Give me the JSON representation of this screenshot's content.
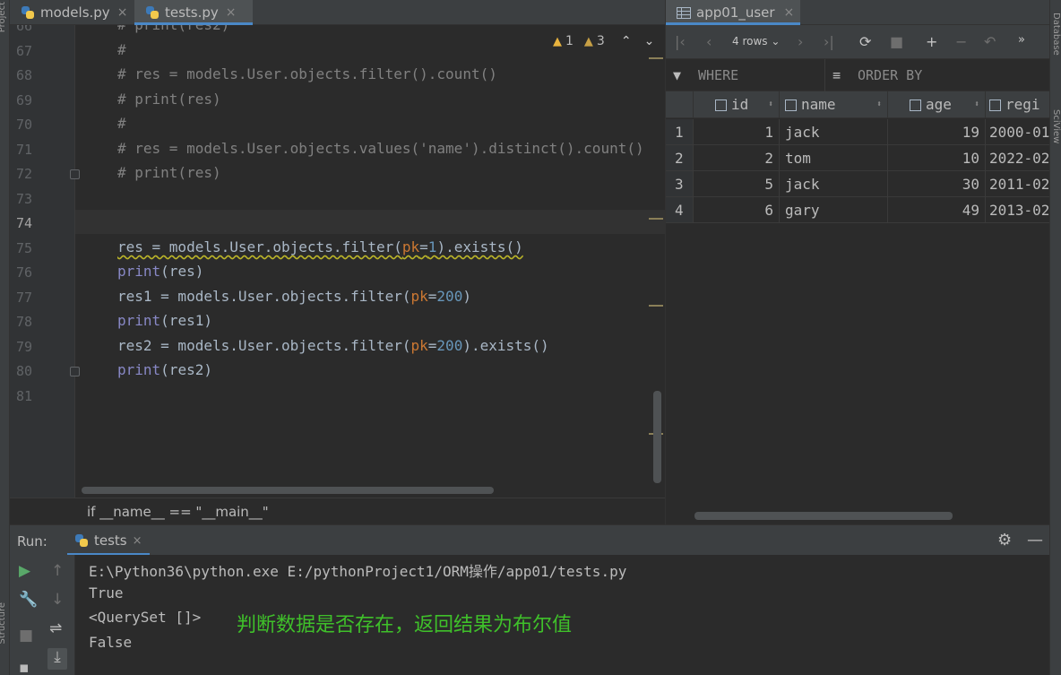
{
  "side_labels": {
    "left_top": "Project",
    "left_bottom": "Structure",
    "right_top": "Database",
    "right_mid": "SciView"
  },
  "editor_tabs": [
    {
      "label": "models.py",
      "close": "×"
    },
    {
      "label": "tests.py",
      "close": "×"
    }
  ],
  "inspections": {
    "warnings": "1",
    "weak_warnings": "3"
  },
  "line_numbers": [
    "66",
    "67",
    "68",
    "69",
    "70",
    "71",
    "72",
    "73",
    "74",
    "75",
    "76",
    "77",
    "78",
    "79",
    "80",
    "81"
  ],
  "code": {
    "l66": "# print(res2)",
    "l67": "#",
    "l68": "# res = models.User.objects.filter().count()",
    "l69": "# print(res)",
    "l70": "#",
    "l71": "# res = models.User.objects.values('name').distinct().count()",
    "l72": "# print(res)",
    "l75": {
      "a": "res = models.User.objects.filter(",
      "pk": "pk",
      "eq": "=",
      "num": "1",
      "b": ").exists()"
    },
    "l76": {
      "fn": "print",
      "rest": "(res)"
    },
    "l77": {
      "a": "res1 = models.User.objects.filter(",
      "pk": "pk",
      "eq": "=",
      "num": "200",
      "b": ")"
    },
    "l78": {
      "fn": "print",
      "rest": "(res1)"
    },
    "l79": {
      "a": "res2 = models.User.objects.filter(",
      "pk": "pk",
      "eq": "=",
      "num": "200",
      "b": ").exists()"
    },
    "l80": {
      "fn": "print",
      "rest": "(res2)"
    }
  },
  "breadcrumb": "if __name__ == \"__main__\"",
  "db": {
    "tab_label": "app01_user",
    "tab_close": "×",
    "rows_label": "4 rows",
    "where_label": "WHERE",
    "order_label": "ORDER BY",
    "columns": [
      "id",
      "name",
      "age",
      "regi"
    ],
    "rows": [
      {
        "n": "1",
        "id": "1",
        "name": "jack",
        "age": "19",
        "reg": "2000-01"
      },
      {
        "n": "2",
        "id": "2",
        "name": "tom",
        "age": "10",
        "reg": "2022-02"
      },
      {
        "n": "3",
        "id": "5",
        "name": "jack",
        "age": "30",
        "reg": "2011-02"
      },
      {
        "n": "4",
        "id": "6",
        "name": "gary",
        "age": "49",
        "reg": "2013-02"
      }
    ]
  },
  "run": {
    "label": "Run:",
    "tab_label": "tests",
    "tab_close": "×",
    "output": [
      "E:\\Python36\\python.exe E:/pythonProject1/ORM操作/app01/tests.py",
      "True",
      "<QuerySet []>",
      "False"
    ],
    "annotation": "判断数据是否存在，返回结果为布尔值"
  },
  "colors": {
    "accent": "#4a88c7",
    "annotation": "#3fc02a",
    "comment": "#808080",
    "keyword": "#cc7832",
    "number": "#6897bb"
  }
}
